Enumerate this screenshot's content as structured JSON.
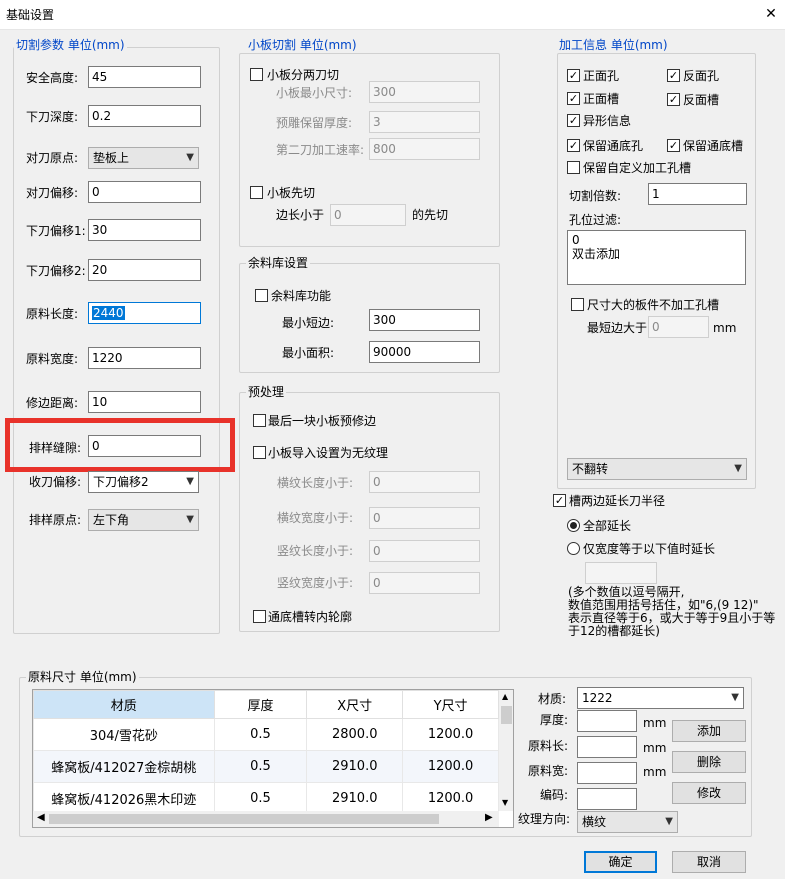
{
  "window": {
    "title": "基础设置",
    "close_glyph": "✕"
  },
  "cut_params": {
    "title": "切割参数 单位(mm)",
    "fields": [
      {
        "label": "安全高度:",
        "value": "45"
      },
      {
        "label": "下刀深度:",
        "value": "0.2"
      },
      {
        "label": "对刀原点:",
        "value": "垫板上"
      },
      {
        "label": "对刀偏移:",
        "value": "0"
      },
      {
        "label": "下刀偏移1:",
        "value": "30"
      },
      {
        "label": "下刀偏移2:",
        "value": "20"
      },
      {
        "label": "原料长度:",
        "value": "2440"
      },
      {
        "label": "原料宽度:",
        "value": "1220"
      },
      {
        "label": "修边距离:",
        "value": "10"
      },
      {
        "label": "排样缝隙:",
        "value": "0"
      },
      {
        "label": "收刀偏移:",
        "value": "下刀偏移2"
      },
      {
        "label": "排样原点:",
        "value": "左下角"
      }
    ]
  },
  "small_board": {
    "title": "小板切割 单位(mm)",
    "two_cut": {
      "label": "小板分两刀切",
      "checked": false
    },
    "min_size": {
      "label": "小板最小尺寸:",
      "value": "300"
    },
    "reserve_thickness": {
      "label": "预雕保留厚度:",
      "value": "3"
    },
    "second_speed": {
      "label": "第二刀加工速率:",
      "value": "800"
    },
    "first_cut": {
      "label": "小板先切",
      "checked": false
    },
    "edge_less": {
      "label": "边长小于",
      "value": "0",
      "suffix": "的先切"
    }
  },
  "remnant": {
    "title": "余料库设置",
    "enable": {
      "label": "余料库功能",
      "checked": false
    },
    "min_short": {
      "label": "最小短边:",
      "value": "300"
    },
    "min_area": {
      "label": "最小面积:",
      "value": "90000"
    }
  },
  "preprocess": {
    "title": "预处理",
    "last_trim": {
      "label": "最后一块小板预修边",
      "checked": false
    },
    "no_grain": {
      "label": "小板导入设置为无纹理",
      "checked": false
    },
    "h_len": {
      "label": "横纹长度小于:",
      "value": "0"
    },
    "h_wid": {
      "label": "横纹宽度小于:",
      "value": "0"
    },
    "v_len": {
      "label": "竖纹长度小于:",
      "value": "0"
    },
    "v_wid": {
      "label": "竖纹宽度小于:",
      "value": "0"
    },
    "groove_inner": {
      "label": "通底槽转内轮廓",
      "checked": false
    }
  },
  "process_info": {
    "title": "加工信息 单位(mm)",
    "front_hole": {
      "label": "正面孔",
      "checked": true
    },
    "back_hole": {
      "label": "反面孔",
      "checked": true
    },
    "front_groove": {
      "label": "正面槽",
      "checked": true
    },
    "back_groove": {
      "label": "反面槽",
      "checked": true
    },
    "irregular": {
      "label": "异形信息",
      "checked": true
    },
    "keep_through_hole": {
      "label": "保留通底孔",
      "checked": true
    },
    "keep_through_groove": {
      "label": "保留通底槽",
      "checked": true
    },
    "keep_custom": {
      "label": "保留自定义加工孔槽",
      "checked": false
    },
    "cut_multiple": {
      "label": "切割倍数:",
      "value": "1"
    },
    "hole_filter": {
      "label": "孔位过滤:",
      "lines": [
        "0",
        "双击添加"
      ]
    },
    "big_board": {
      "label": "尺寸大的板件不加工孔槽",
      "checked": false
    },
    "min_edge": {
      "label": "最短边大于",
      "value": "0",
      "unit": "mm"
    },
    "flip": {
      "value": "不翻转"
    }
  },
  "groove_extend": {
    "label": "槽两边延长刀半径",
    "checked": true,
    "all": {
      "label": "全部延长",
      "checked": true
    },
    "only_width": {
      "label": "仅宽度等于以下值时延长",
      "checked": false
    },
    "note": [
      "(多个数值以逗号隔开,",
      "数值范围用括号括住，如\"6,(9 12)\"",
      "表示直径等于6，或大于等于9且小于等",
      "于12的槽都延长)"
    ]
  },
  "material": {
    "title": "原料尺寸 单位(mm)",
    "columns": [
      "材质",
      "厚度",
      "X尺寸",
      "Y尺寸"
    ],
    "rows": [
      [
        "304/雪花砂",
        "0.5",
        "2800.0",
        "1200.0"
      ],
      [
        "蜂窝板/412027金棕胡桃",
        "0.5",
        "2910.0",
        "1200.0"
      ],
      [
        "蜂窝板/412026黑木印迹",
        "0.5",
        "2910.0",
        "1200.0"
      ]
    ],
    "form": {
      "material": {
        "label": "材质:",
        "value": "1222"
      },
      "thickness": {
        "label": "厚度:",
        "value": "",
        "unit": "mm"
      },
      "length": {
        "label": "原料长:",
        "value": "",
        "unit": "mm"
      },
      "width": {
        "label": "原料宽:",
        "value": "",
        "unit": "mm"
      },
      "code": {
        "label": "编码:",
        "value": ""
      },
      "grain": {
        "label": "纹理方向:",
        "value": "横纹"
      }
    },
    "buttons": {
      "add": "添加",
      "delete": "删除",
      "modify": "修改"
    }
  },
  "footer": {
    "ok": "确定",
    "cancel": "取消"
  },
  "colors": {
    "accent": "#0078d7",
    "highlight": "#e8322a",
    "group_title": "#0046c8"
  }
}
